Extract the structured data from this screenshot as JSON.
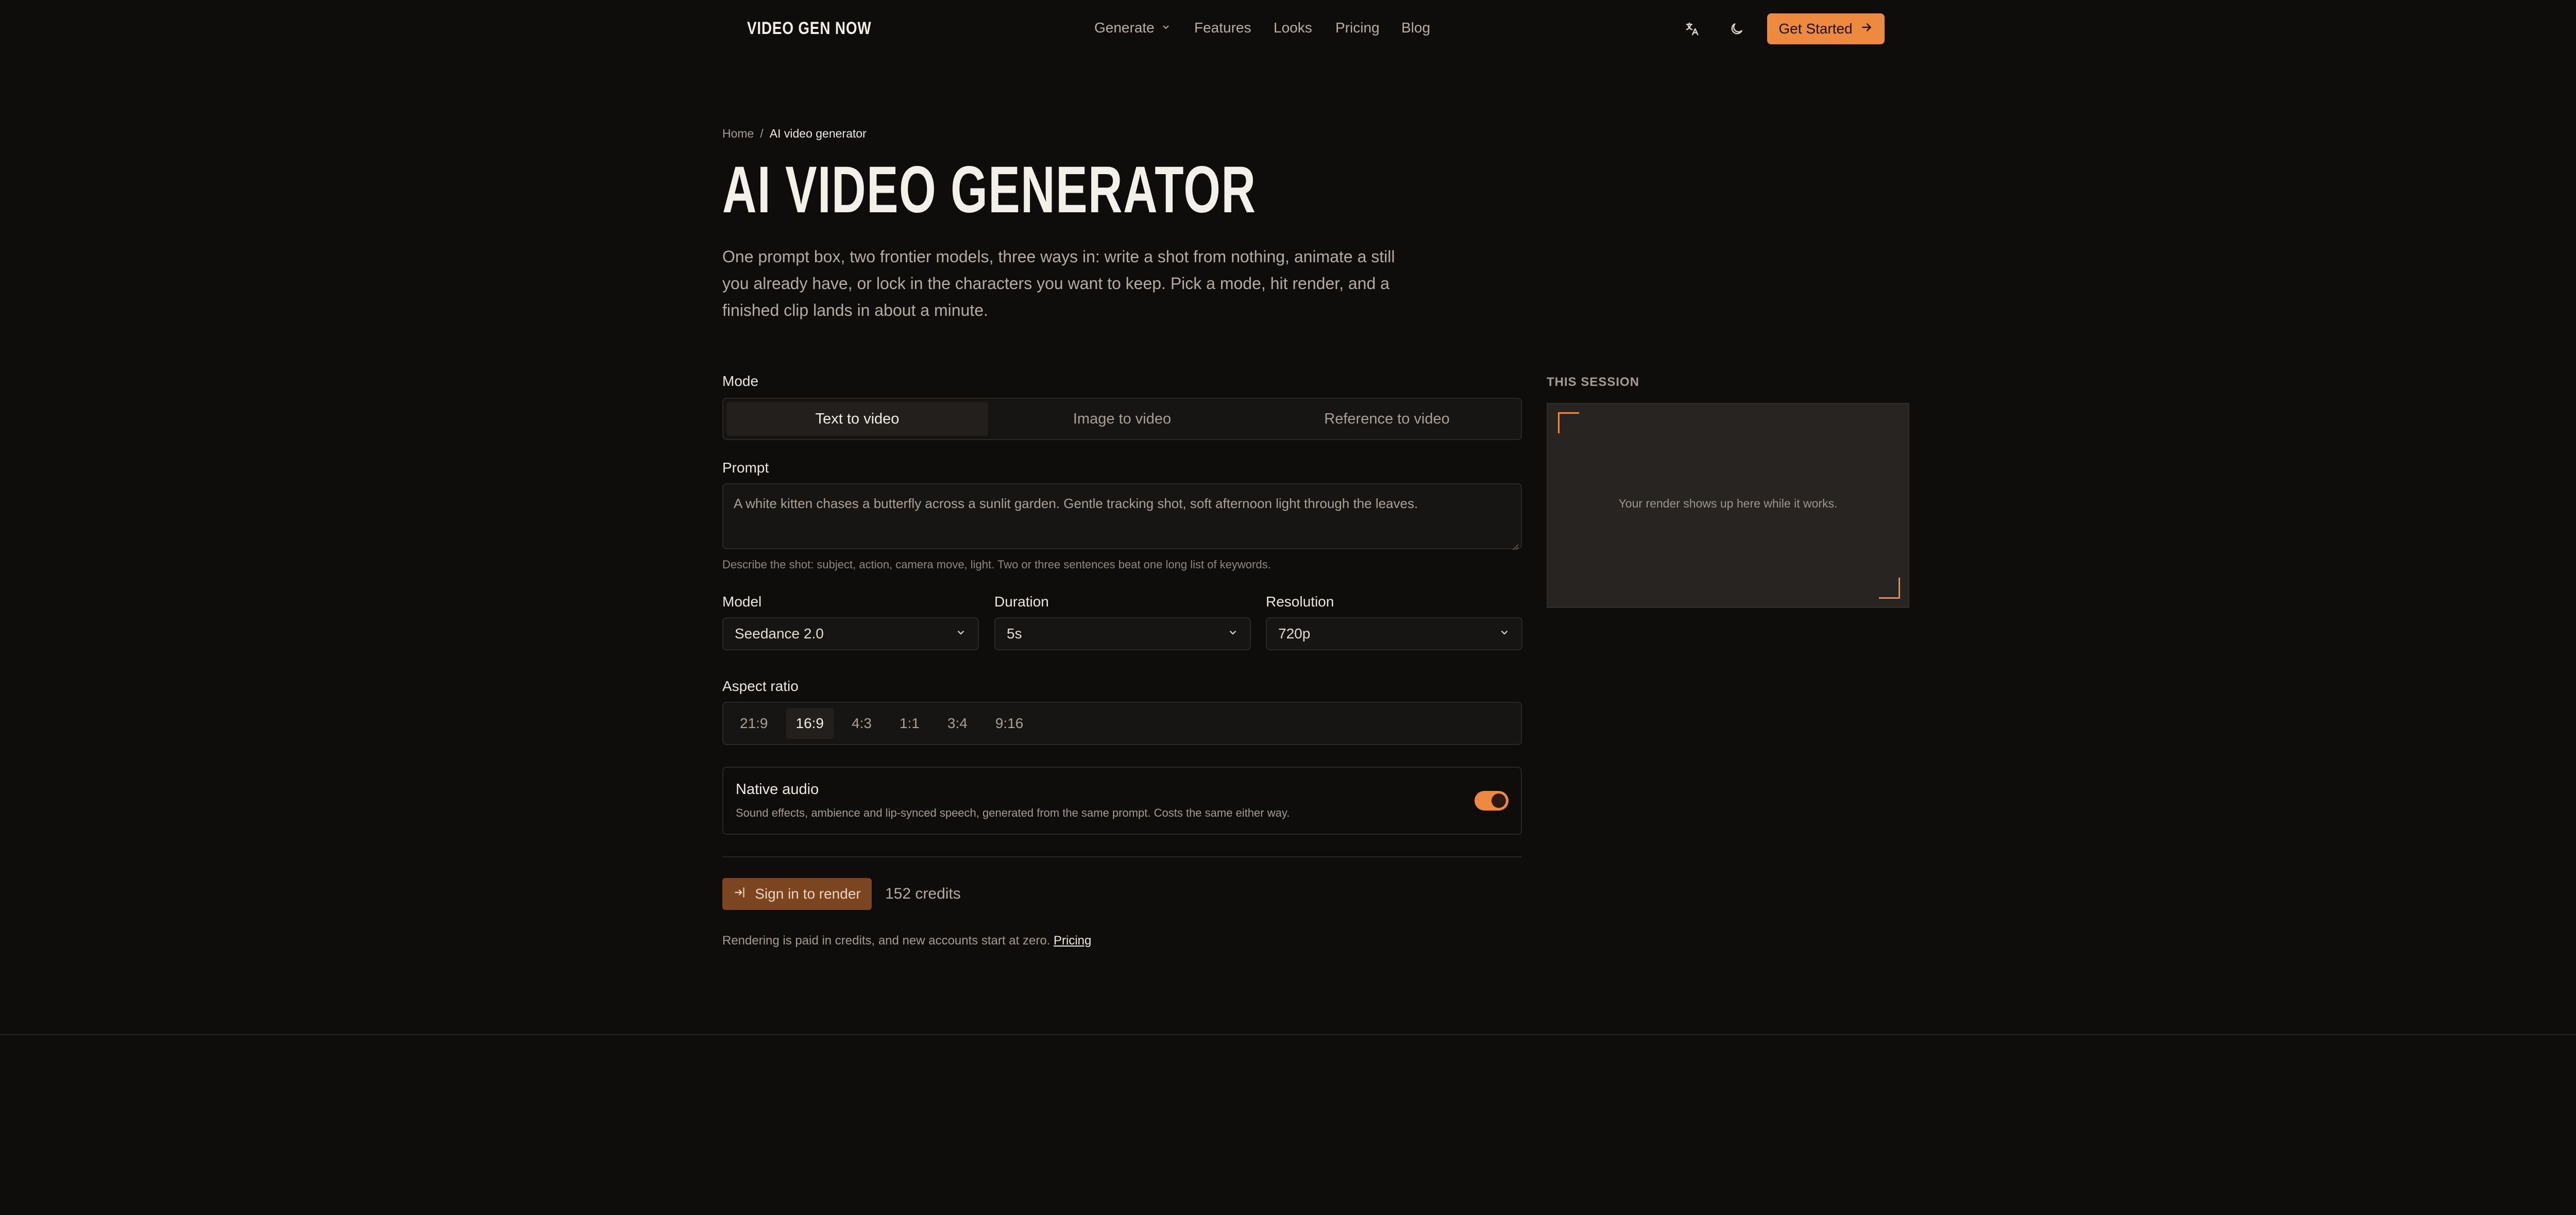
{
  "header": {
    "logo": "VIDEO GEN NOW",
    "nav": [
      {
        "label": "Generate"
      },
      {
        "label": "Features"
      },
      {
        "label": "Looks"
      },
      {
        "label": "Pricing"
      },
      {
        "label": "Blog"
      }
    ],
    "cta_label": "Get Started",
    "icons": [
      "translate-icon",
      "moon-icon",
      "arrow-right-icon"
    ]
  },
  "breadcrumb": {
    "home": "Home",
    "separator": "/",
    "current": "AI video generator"
  },
  "hero": {
    "title": "AI VIDEO GENERATOR",
    "lede": "One prompt box, two frontier models, three ways in: write a shot from nothing, animate a still you already have, or lock in the characters you want to keep. Pick a mode, hit render, and a finished clip lands in about a minute."
  },
  "form": {
    "mode_label": "Mode",
    "modes": [
      "Text to video",
      "Image to video",
      "Reference to video"
    ],
    "active_mode": "Text to video",
    "prompt_label": "Prompt",
    "prompt_value": "A white kitten chases a butterfly across a sunlit garden. Gentle tracking shot, soft afternoon light through the leaves.",
    "prompt_help": "Describe the shot: subject, action, camera move, light. Two or three sentences beat one long list of keywords.",
    "model_label": "Model",
    "model_value": "Seedance 2.0",
    "duration_label": "Duration",
    "duration_value": "5s",
    "resolution_label": "Resolution",
    "resolution_value": "720p",
    "aspect_label": "Aspect ratio",
    "aspect_options": [
      "21:9",
      "16:9",
      "4:3",
      "1:1",
      "3:4",
      "9:16"
    ],
    "aspect_selected": "16:9",
    "audio_title": "Native audio",
    "audio_desc": "Sound effects, ambience and lip-synced speech, generated from the same prompt. Costs the same either way.",
    "audio_on": true,
    "signin_label": "Sign in to render",
    "credits": "152 credits",
    "footnote": "Rendering is paid in credits, and new accounts start at zero.",
    "footnote_link": "Pricing"
  },
  "session": {
    "label": "THIS SESSION",
    "placeholder": "Your render shows up here while it works."
  },
  "colors": {
    "accent": "#ee8a3f",
    "background": "#0f0d0c",
    "panel": "#272422",
    "signin": "#7a4520"
  }
}
